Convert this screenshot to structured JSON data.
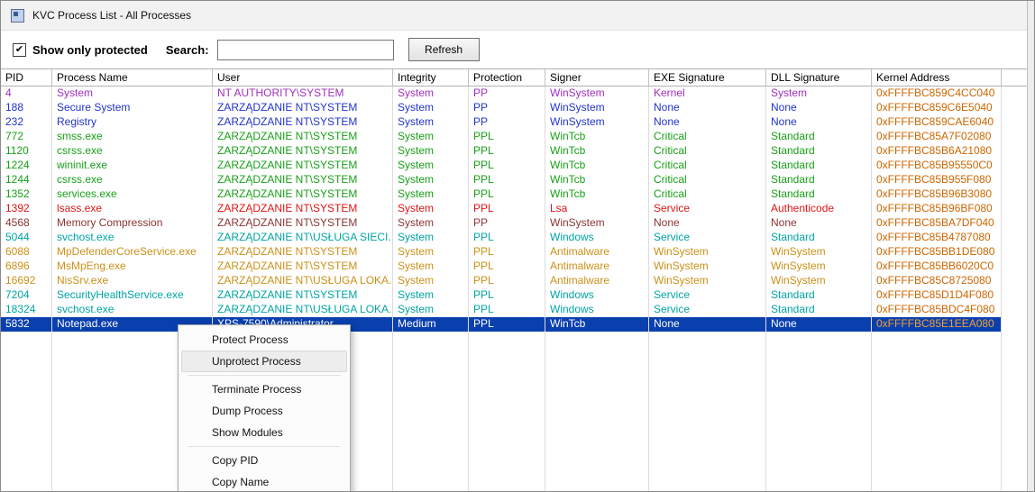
{
  "window": {
    "title": "KVC Process List - All Processes"
  },
  "icons": {
    "checkmark": "✔"
  },
  "toolbar": {
    "show_only_protected_label": "Show only protected",
    "checkbox_checked": true,
    "search_label": "Search:",
    "search_value": "",
    "refresh_label": "Refresh"
  },
  "colors": {
    "kernel_address": "#CC6600",
    "selected_bg": "#0A3FAE",
    "selected_fg": "#FFFFFF",
    "selected_kernel": "#F0A030"
  },
  "table": {
    "columns": [
      "PID",
      "Process Name",
      "User",
      "Integrity",
      "Protection",
      "Signer",
      "EXE Signature",
      "DLL Signature",
      "Kernel Address"
    ],
    "rows": [
      {
        "pid": "4",
        "name": "System",
        "user": "NT AUTHORITY\\SYSTEM",
        "integrity": "System",
        "protection": "PP",
        "signer": "WinSystem",
        "exe_sig": "Kernel",
        "dll_sig": "System",
        "kernel_addr": "0xFFFFBC859C4CC040",
        "color": "#A030C0",
        "selected": false
      },
      {
        "pid": "188",
        "name": "Secure System",
        "user": "ZARZĄDZANIE NT\\SYSTEM",
        "integrity": "System",
        "protection": "PP",
        "signer": "WinSystem",
        "exe_sig": "None",
        "dll_sig": "None",
        "kernel_addr": "0xFFFFBC859C6E5040",
        "color": "#2233CC",
        "selected": false
      },
      {
        "pid": "232",
        "name": "Registry",
        "user": "ZARZĄDZANIE NT\\SYSTEM",
        "integrity": "System",
        "protection": "PP",
        "signer": "WinSystem",
        "exe_sig": "None",
        "dll_sig": "None",
        "kernel_addr": "0xFFFFBC859CAE6040",
        "color": "#2233CC",
        "selected": false
      },
      {
        "pid": "772",
        "name": "smss.exe",
        "user": "ZARZĄDZANIE NT\\SYSTEM",
        "integrity": "System",
        "protection": "PPL",
        "signer": "WinTcb",
        "exe_sig": "Critical",
        "dll_sig": "Standard",
        "kernel_addr": "0xFFFFBC85A7F02080",
        "color": "#18A018",
        "selected": false
      },
      {
        "pid": "1120",
        "name": "csrss.exe",
        "user": "ZARZĄDZANIE NT\\SYSTEM",
        "integrity": "System",
        "protection": "PPL",
        "signer": "WinTcb",
        "exe_sig": "Critical",
        "dll_sig": "Standard",
        "kernel_addr": "0xFFFFBC85B6A21080",
        "color": "#18A018",
        "selected": false
      },
      {
        "pid": "1224",
        "name": "wininit.exe",
        "user": "ZARZĄDZANIE NT\\SYSTEM",
        "integrity": "System",
        "protection": "PPL",
        "signer": "WinTcb",
        "exe_sig": "Critical",
        "dll_sig": "Standard",
        "kernel_addr": "0xFFFFBC85B95550C0",
        "color": "#18A018",
        "selected": false
      },
      {
        "pid": "1244",
        "name": "csrss.exe",
        "user": "ZARZĄDZANIE NT\\SYSTEM",
        "integrity": "System",
        "protection": "PPL",
        "signer": "WinTcb",
        "exe_sig": "Critical",
        "dll_sig": "Standard",
        "kernel_addr": "0xFFFFBC85B955F080",
        "color": "#18A018",
        "selected": false
      },
      {
        "pid": "1352",
        "name": "services.exe",
        "user": "ZARZĄDZANIE NT\\SYSTEM",
        "integrity": "System",
        "protection": "PPL",
        "signer": "WinTcb",
        "exe_sig": "Critical",
        "dll_sig": "Standard",
        "kernel_addr": "0xFFFFBC85B96B3080",
        "color": "#18A018",
        "selected": false
      },
      {
        "pid": "1392",
        "name": "lsass.exe",
        "user": "ZARZĄDZANIE NT\\SYSTEM",
        "integrity": "System",
        "protection": "PPL",
        "signer": "Lsa",
        "exe_sig": "Service",
        "dll_sig": "Authenticode",
        "kernel_addr": "0xFFFFBC85B96BF080",
        "color": "#E01414",
        "selected": false
      },
      {
        "pid": "4568",
        "name": "Memory Compression",
        "user": "ZARZĄDZANIE NT\\SYSTEM",
        "integrity": "System",
        "protection": "PP",
        "signer": "WinSystem",
        "exe_sig": "None",
        "dll_sig": "None",
        "kernel_addr": "0xFFFFBC85BA7DF040",
        "color": "#8B3434",
        "selected": false
      },
      {
        "pid": "5044",
        "name": "svchost.exe",
        "user": "ZARZĄDZANIE NT\\USŁUGA SIECI...",
        "integrity": "System",
        "protection": "PPL",
        "signer": "Windows",
        "exe_sig": "Service",
        "dll_sig": "Standard",
        "kernel_addr": "0xFFFFBC85B4787080",
        "color": "#00A4A4",
        "selected": false
      },
      {
        "pid": "6088",
        "name": "MpDefenderCoreService.exe",
        "user": "ZARZĄDZANIE NT\\SYSTEM",
        "integrity": "System",
        "protection": "PPL",
        "signer": "Antimalware",
        "exe_sig": "WinSystem",
        "dll_sig": "WinSystem",
        "kernel_addr": "0xFFFFBC85BB1DE080",
        "color": "#CC9018",
        "selected": false
      },
      {
        "pid": "6896",
        "name": "MsMpEng.exe",
        "user": "ZARZĄDZANIE NT\\SYSTEM",
        "integrity": "System",
        "protection": "PPL",
        "signer": "Antimalware",
        "exe_sig": "WinSystem",
        "dll_sig": "WinSystem",
        "kernel_addr": "0xFFFFBC85BB6020C0",
        "color": "#CC9018",
        "selected": false
      },
      {
        "pid": "16692",
        "name": "NisSrv.exe",
        "user": "ZARZĄDZANIE NT\\USŁUGA LOKA...",
        "integrity": "System",
        "protection": "PPL",
        "signer": "Antimalware",
        "exe_sig": "WinSystem",
        "dll_sig": "WinSystem",
        "kernel_addr": "0xFFFFBC85C8725080",
        "color": "#CC9018",
        "selected": false
      },
      {
        "pid": "7204",
        "name": "SecurityHealthService.exe",
        "user": "ZARZĄDZANIE NT\\SYSTEM",
        "integrity": "System",
        "protection": "PPL",
        "signer": "Windows",
        "exe_sig": "Service",
        "dll_sig": "Standard",
        "kernel_addr": "0xFFFFBC85D1D4F080",
        "color": "#00A4A4",
        "selected": false
      },
      {
        "pid": "18324",
        "name": "svchost.exe",
        "user": "ZARZĄDZANIE NT\\USŁUGA LOKA...",
        "integrity": "System",
        "protection": "PPL",
        "signer": "Windows",
        "exe_sig": "Service",
        "dll_sig": "Standard",
        "kernel_addr": "0xFFFFBC85BDC4F080",
        "color": "#00A4A4",
        "selected": false
      },
      {
        "pid": "5832",
        "name": "Notepad.exe",
        "user": "XPS-7590\\Administrator",
        "integrity": "Medium",
        "protection": "PPL",
        "signer": "WinTcb",
        "exe_sig": "None",
        "dll_sig": "None",
        "kernel_addr": "0xFFFFBC85E1EEA080",
        "color": "#FFFFFF",
        "selected": true
      }
    ]
  },
  "context_menu": {
    "items": [
      {
        "label": "Protect Process",
        "highlighted": false
      },
      {
        "label": "Unprotect Process",
        "highlighted": true
      },
      {
        "separator": true
      },
      {
        "label": "Terminate Process",
        "highlighted": false
      },
      {
        "label": "Dump Process",
        "highlighted": false
      },
      {
        "label": "Show Modules",
        "highlighted": false
      },
      {
        "separator": true
      },
      {
        "label": "Copy PID",
        "highlighted": false
      },
      {
        "label": "Copy Name",
        "highlighted": false
      }
    ]
  }
}
